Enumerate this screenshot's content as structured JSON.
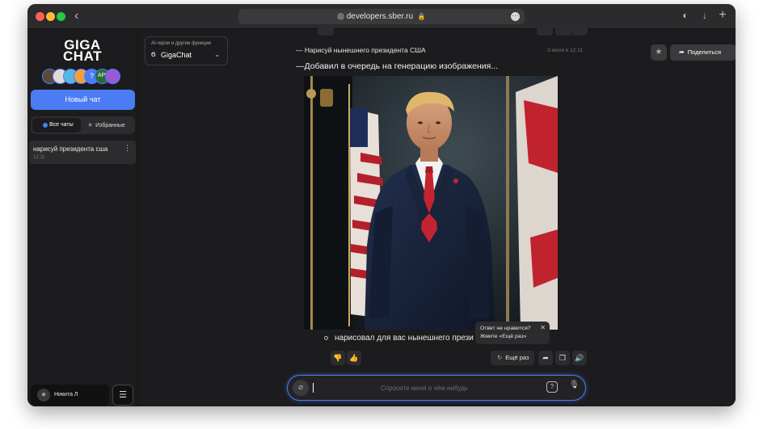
{
  "browser": {
    "url": "developers.sber.ru",
    "controls": {
      "back": "‹",
      "download": "↓",
      "new_tab": "+"
    }
  },
  "sidebar": {
    "logo_line1": "GIGA",
    "logo_line2": "CHAT",
    "new_chat_label": "Новый чат",
    "tabs": [
      {
        "label": "Все чаты",
        "active": true
      },
      {
        "label": "Избранные",
        "active": false
      }
    ],
    "chats": [
      {
        "title": "нарисуй президента сша",
        "time": "12:11"
      }
    ],
    "user_name": "Никита Л",
    "avatars": [
      "",
      "",
      "",
      "",
      "?",
      "API",
      ""
    ]
  },
  "header": {
    "model_caption": "AI-герои и другие функции",
    "model_name": "GigaChat",
    "share_label": "Поделиться"
  },
  "conversation": {
    "user_message": "— Нарисуй нынешнего президента США",
    "message_time": "3 июля в 12:11",
    "bot_message": "—Добавил в очередь на генерацию изображения...",
    "bullet_text": "нарисовал для вас нынешнего прези",
    "tooltip_line1": "Ответ не нравится?",
    "tooltip_line2": "Жмите «Ещё раз»",
    "retry_label": "Ещё раз"
  },
  "composer": {
    "placeholder": "Спросите меня о чём-нибудь",
    "value": ""
  },
  "colors": {
    "accent": "#4b7cf3",
    "background": "#1c1c1e",
    "panel": "#2c2c2e"
  }
}
